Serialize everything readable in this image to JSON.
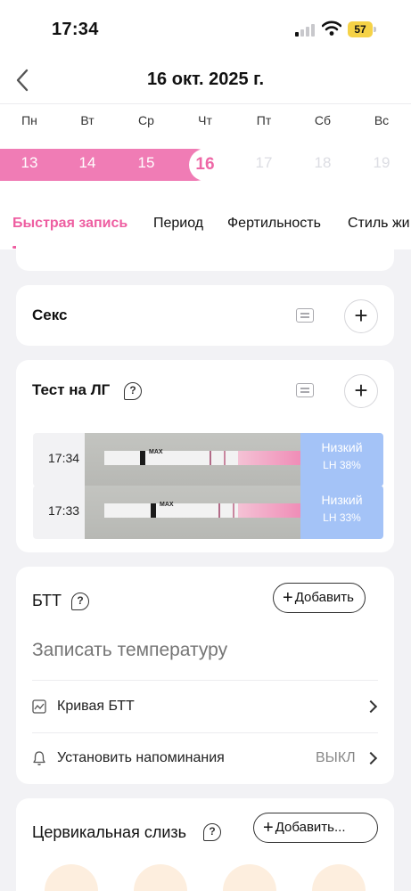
{
  "status_bar": {
    "time": "17:34",
    "battery": "57"
  },
  "header": {
    "title": "16 окт. 2025 г."
  },
  "week": {
    "weekdays": [
      "Пн",
      "Вт",
      "Ср",
      "Чт",
      "Пт",
      "Сб",
      "Вс"
    ],
    "days": [
      "13",
      "14",
      "15",
      "16",
      "17",
      "18",
      "19"
    ],
    "selected_day": "16"
  },
  "tabs": [
    "Быстрая запись",
    "Период",
    "Фертильность",
    "Стиль жи"
  ],
  "sex_card": {
    "title": "Секс"
  },
  "lh_card": {
    "title": "Тест на ЛГ",
    "entries": [
      {
        "time": "17:34",
        "result": "Низкий",
        "percent": "LH 38%"
      },
      {
        "time": "17:33",
        "result": "Низкий",
        "percent": "LH 33%"
      }
    ],
    "strip_label": "MAX"
  },
  "btt_card": {
    "title": "БТТ",
    "add_label": "Добавить",
    "placeholder": "Записать температуру",
    "curve_label": "Кривая БТТ",
    "reminder_label": "Установить напоминания",
    "reminder_value": "ВЫКЛ"
  },
  "mucus_card": {
    "title": "Цервикальная слизь",
    "add_label": "Добавить..."
  },
  "colors": {
    "accent": "#ee5ea1",
    "band": "#f07cb5",
    "result": "#a4c3f7"
  }
}
